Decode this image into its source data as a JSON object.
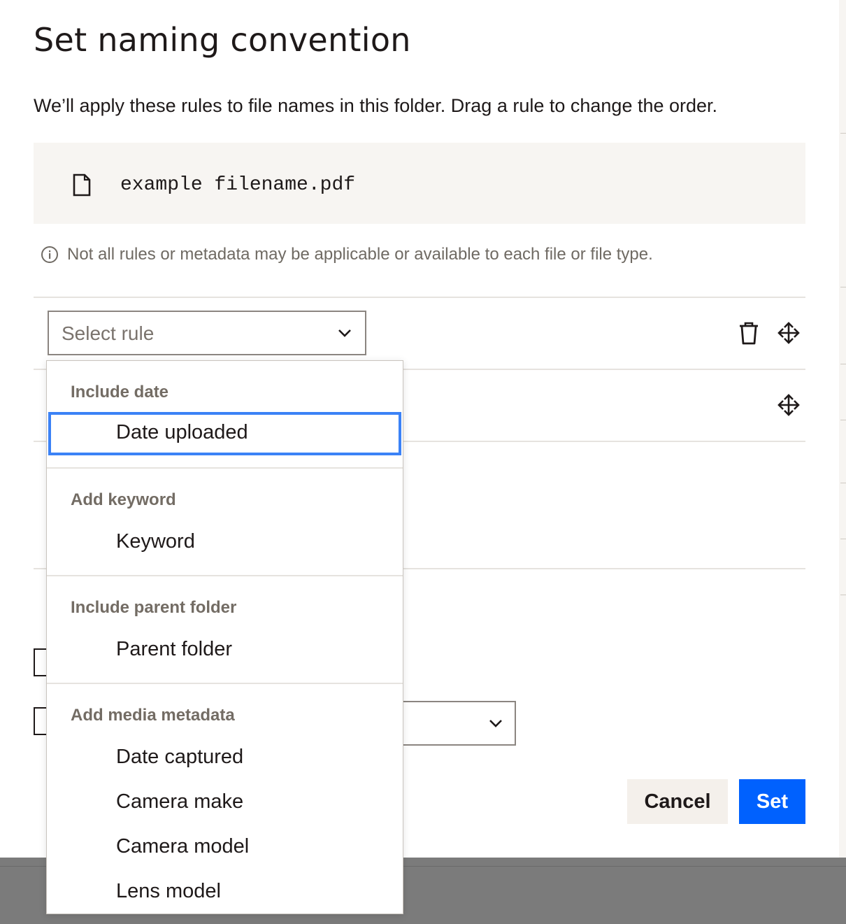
{
  "modal": {
    "title": "Set naming convention",
    "subtitle": "We’ll apply these rules to file names in this folder. Drag a rule to change the order.",
    "preview_filename": "example filename.pdf",
    "notice": "Not all rules or metadata may be applicable or available to each file or file type."
  },
  "rule_select": {
    "placeholder": "Select rule"
  },
  "menu": {
    "groups": [
      {
        "label": "Include date",
        "items": [
          "Date uploaded"
        ]
      },
      {
        "label": "Add keyword",
        "items": [
          "Keyword"
        ]
      },
      {
        "label": "Include parent folder",
        "items": [
          "Parent folder"
        ]
      },
      {
        "label": "Add media metadata",
        "items": [
          "Date captured",
          "Camera make",
          "Camera model",
          "Lens model"
        ]
      }
    ],
    "focused_item": "Date uploaded"
  },
  "buttons": {
    "cancel": "Cancel",
    "set": "Set"
  },
  "colors": {
    "primary": "#0061fe",
    "focus_ring": "#3b82f6",
    "preview_bg": "#f7f5f2",
    "cancel_bg": "#f4f0eb"
  }
}
